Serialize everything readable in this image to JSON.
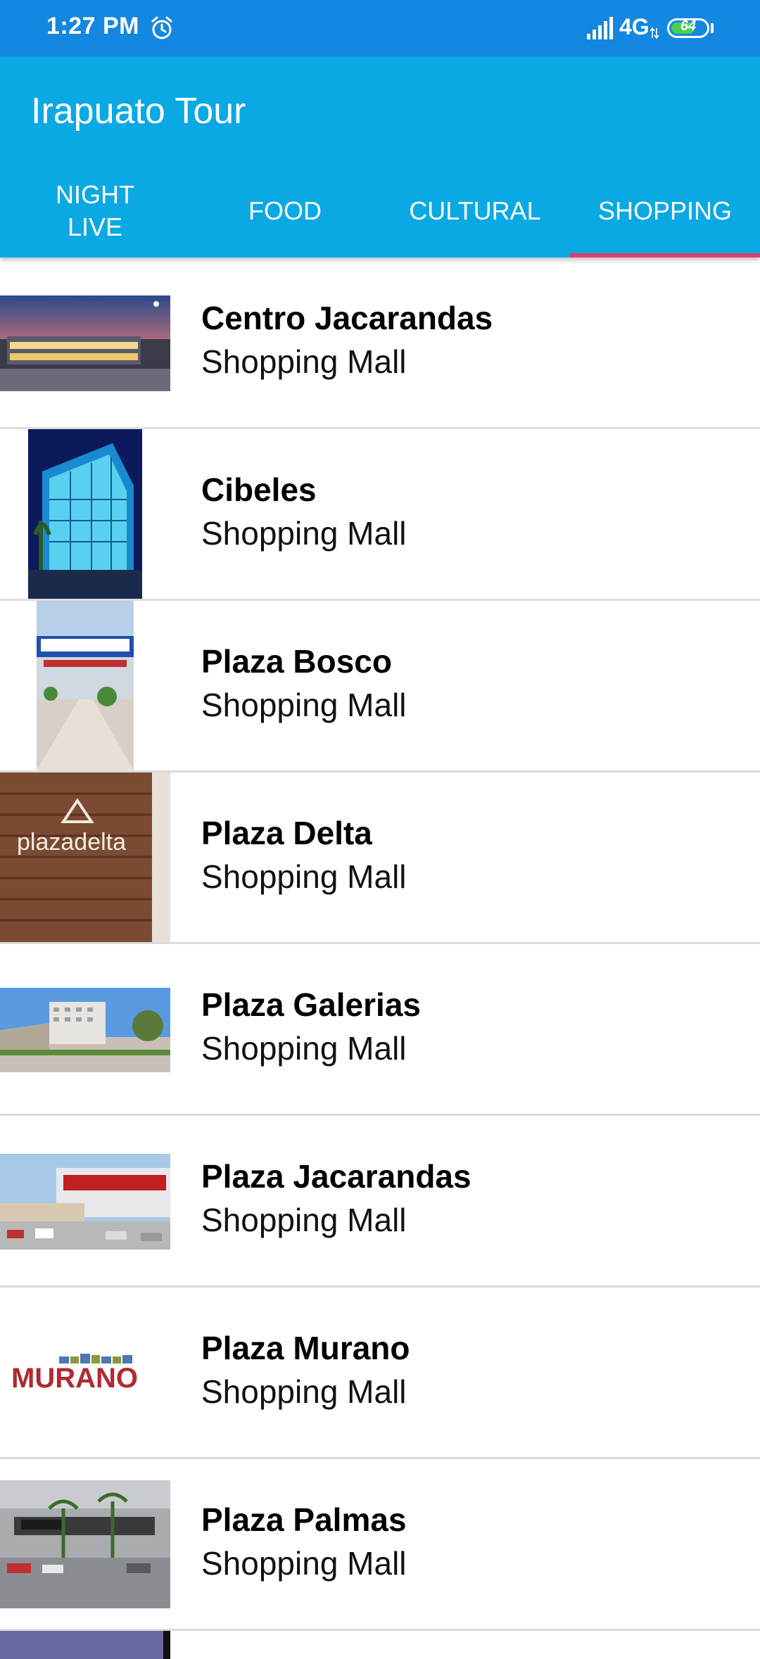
{
  "status_bar": {
    "time": "1:27 PM",
    "network": "4G",
    "battery_level": "64",
    "alarm_icon": "alarm-clock-icon",
    "signal_icon": "cell-signal-icon"
  },
  "app_bar": {
    "title": "Irapuato Tour"
  },
  "tabs": [
    {
      "label": "NIGHT\nLIVE",
      "selected": false
    },
    {
      "label": "FOOD",
      "selected": false
    },
    {
      "label": "CULTURAL",
      "selected": false
    },
    {
      "label": "SHOPPING",
      "selected": true
    }
  ],
  "colors": {
    "status_bar": "#1487e0",
    "app_bar": "#0aa9e3",
    "tab_indicator": "#e03b6a",
    "battery_fill": "#48d050"
  },
  "items": [
    {
      "title": "Centro Jacarandas",
      "subtitle": "Shopping Mall",
      "image": "mall-at-dusk-photo"
    },
    {
      "title": "Cibeles",
      "subtitle": "Shopping Mall",
      "image": "glass-building-photo"
    },
    {
      "title": "Plaza Bosco",
      "subtitle": "Shopping Mall",
      "image": "don-bosco-entrance-photo"
    },
    {
      "title": "Plaza Delta",
      "subtitle": "Shopping Mall",
      "image": "plazadelta-sign-photo"
    },
    {
      "title": "Plaza Galerias",
      "subtitle": "Shopping Mall",
      "image": "galerias-exterior-photo"
    },
    {
      "title": "Plaza Jacarandas",
      "subtitle": "Shopping Mall",
      "image": "soriana-parking-photo"
    },
    {
      "title": "Plaza Murano",
      "subtitle": "Shopping Mall",
      "image": "murano-logo"
    },
    {
      "title": "Plaza Palmas",
      "subtitle": "Shopping Mall",
      "image": "palmas-exterior-photo"
    }
  ]
}
